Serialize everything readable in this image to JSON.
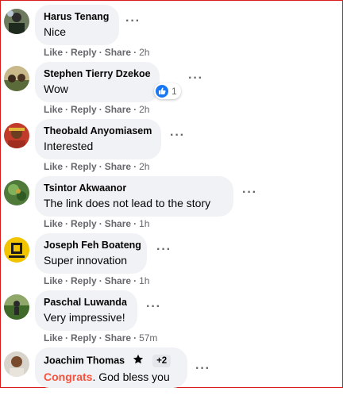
{
  "actions": {
    "like": "Like",
    "reply": "Reply",
    "share": "Share",
    "sep": "·"
  },
  "more_label": "···",
  "comments": [
    {
      "name": "Harus Tenang",
      "text": "Nice",
      "time": "2h"
    },
    {
      "name": "Stephen Tierry Dzekoe",
      "text": "Wow",
      "time": "2h",
      "reaction": {
        "icon": "thumbs-up-icon",
        "count": "1"
      }
    },
    {
      "name": "Theobald Anyomiasem",
      "text": "Interested",
      "time": "2h"
    },
    {
      "name": "Tsintor Akwaanor",
      "text": "The link does not lead to the story",
      "time": "1h"
    },
    {
      "name": "Joseph Feh Boateng",
      "text": "Super innovation",
      "time": "1h"
    },
    {
      "name": "Paschal Luwanda",
      "text": "Very impressive!",
      "time": "57m"
    },
    {
      "name": "Joachim Thomas",
      "badge_extra": "+2",
      "text_highlight": "Congrats",
      "text": ". God bless you",
      "badge_icon": "star-icon"
    }
  ],
  "colors": {
    "accent": "#1877f2",
    "bubble": "#f0f2f5",
    "meta": "#65676b",
    "highlight": "#f5533d",
    "frame": "#d81b1b"
  }
}
